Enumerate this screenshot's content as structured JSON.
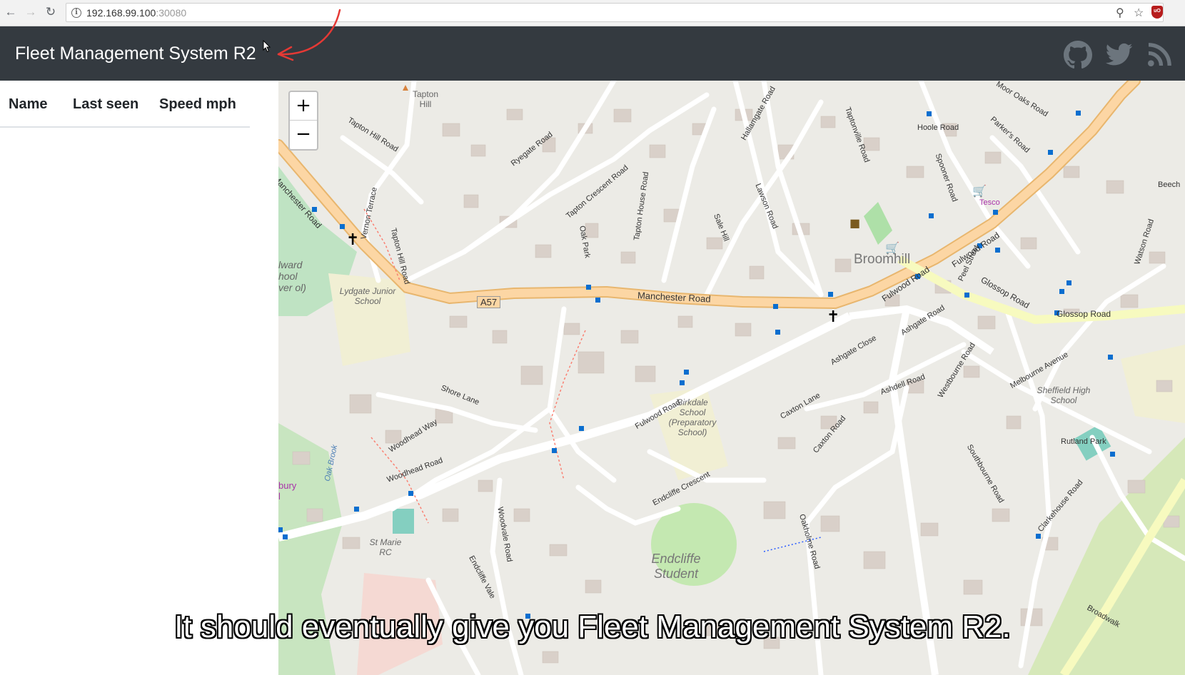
{
  "browser": {
    "url_host": "192.168.99.100",
    "url_port": ":30080"
  },
  "navbar": {
    "brand": "Fleet Management System R2",
    "icons": [
      "github-icon",
      "twitter-icon",
      "rss-icon"
    ]
  },
  "table": {
    "columns": [
      "Name",
      "Last seen",
      "Speed mph"
    ]
  },
  "map": {
    "zoom_in": "+",
    "zoom_out": "−",
    "labels": {
      "manchester_road_1": "Manchester Road",
      "manchester_road_2": "Manchester Road",
      "a57": "A57",
      "fulwood_road_1": "Fulwood Road",
      "fulwood_road_2": "Fulwood Road",
      "fulwood_road_3": "Fulwood Road",
      "glossop_road_1": "Glossop Road",
      "glossop_road_2": "Glossop Road",
      "broomhill": "Broomhill",
      "tapton_hill": "Tapton Hill",
      "tapton_hill_road": "Tapton Hill Road",
      "ryegate_road": "Ryegate Road",
      "tapton_crescent_road": "Tapton Crescent Road",
      "hallamgate_road": "Hallamgate Road",
      "taptonville_road": "Taptonville Road",
      "hoole_road": "Hoole Road",
      "spooner_road": "Spooner Road",
      "lydgate_junior_school": "Lydgate Junior School",
      "shore_lane": "Shore Lane",
      "woodhead_way": "Woodhead Way",
      "woodhead_road": "Woodhead Road",
      "birkdale_school": "Birkdale School (Preparatory School)",
      "ashgate_road": "Ashgate Road",
      "ashgate_close": "Ashgate Close",
      "ashdell_road": "Ashdell Road",
      "caxton_lane": "Caxton Lane",
      "caxton_road": "Caxton Road",
      "endcliffe_crescent": "Endcliffe Crescent",
      "endcliffe_student": "Endcliffe Student",
      "st_marie_rc": "St Marie RC",
      "westbourne_road": "Westbourne Road",
      "melbourne_avenue": "Melbourne Avenue",
      "sheffield_high_school": "Sheffield High School",
      "southbourne_road": "Southbourne Road",
      "clarkehouse_road": "Clarkehouse Road",
      "tesco": "Tesco",
      "oak_park": "Oak Park",
      "tapton_house_road": "Tapton House Road",
      "sale_hill": "Sale Hill",
      "lawson_road": "Lawson Road",
      "vernon_terrace": "Vernon Terrace",
      "tapton_hill_road_2": "Tapton Hill Road",
      "beech": "Beech",
      "moor_oaks_road": "Moor Oaks Road",
      "parkers_road": "Parker's Road",
      "peel_street": "Peel Street",
      "watson_road": "Watson Road",
      "oakholme_road": "Oakholme Road",
      "woodvale_road": "Woodvale Road",
      "endcliffe_vale": "Endcliffe Vale",
      "rutland_park": "Rutland Park",
      "ward_school": "lward hool ver ol)",
      "bury": "bury l",
      "oak_brook": "Oak Brook",
      "broadwalk": "Broadwalk"
    }
  },
  "caption": "It should eventually give you Fleet Management System R2."
}
